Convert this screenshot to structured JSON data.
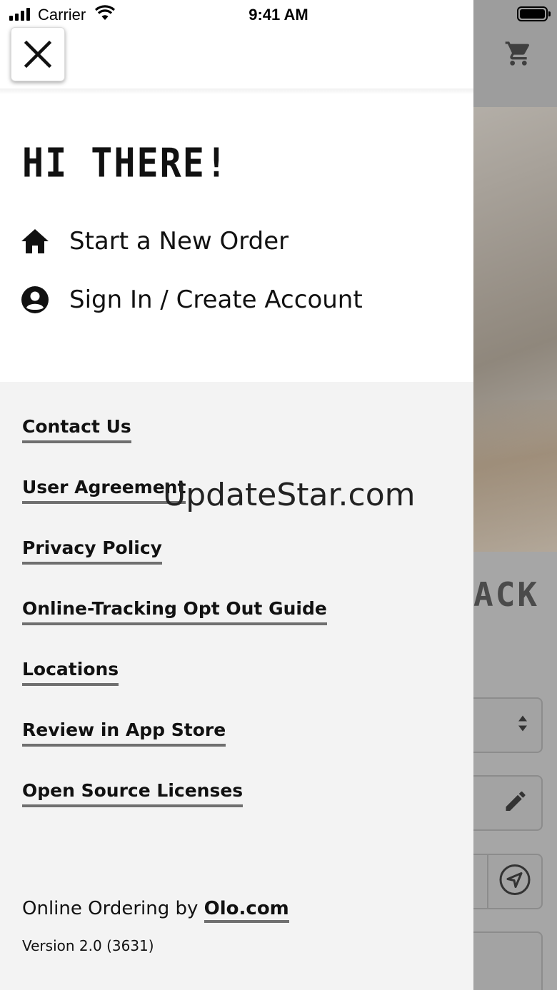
{
  "status_bar": {
    "carrier": "Carrier",
    "time": "9:41 AM"
  },
  "background": {
    "heading_fragment": "ACK",
    "icons": [
      "cart-icon",
      "select-arrows-icon",
      "pencil-icon",
      "navigation-arrow-icon"
    ]
  },
  "drawer": {
    "greeting": "HI THERE!",
    "menu": [
      {
        "label": "Start a New Order",
        "icon": "home-icon"
      },
      {
        "label": "Sign In / Create Account",
        "icon": "account-circle-icon"
      }
    ],
    "links": [
      "Contact Us",
      "User Agreement",
      "Privacy Policy",
      "Online-Tracking Opt Out Guide",
      "Locations",
      "Review in App Store",
      "Open Source Licenses"
    ],
    "footer": {
      "prefix": "Online Ordering by",
      "link": "Olo.com",
      "version": "Version 2.0 (3631)"
    }
  },
  "watermark": "UpdateStar.com"
}
